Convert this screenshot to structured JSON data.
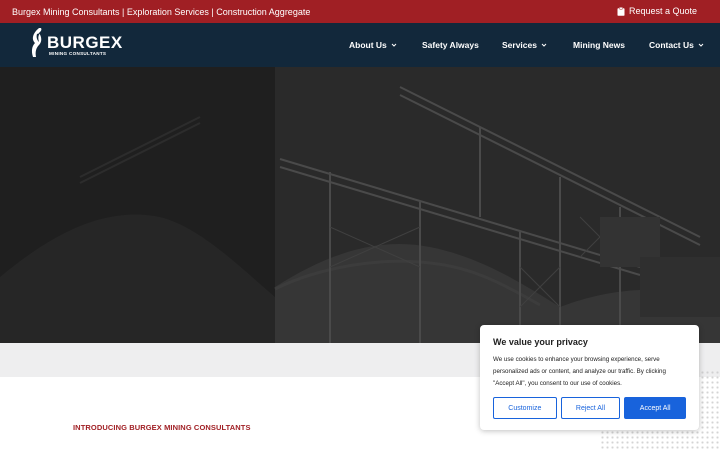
{
  "topbar": {
    "tagline": "Burgex Mining Consultants | Exploration Services | Construction Aggregate",
    "quote_label": "Request a Quote",
    "quote_icon": "clipboard-icon"
  },
  "logo": {
    "word": "BURGEX",
    "sub": "MINING CONSULTANTS"
  },
  "nav": {
    "about": "About Us",
    "safety": "Safety Always",
    "services": "Services",
    "news": "Mining News",
    "contact": "Contact Us"
  },
  "intro": {
    "label": "INTRODUCING BURGEX MINING CONSULTANTS"
  },
  "consent": {
    "title": "We value your privacy",
    "body": "We use cookies to enhance your browsing experience, serve personalized ads or content, and analyze our traffic. By clicking \"Accept All\", you consent to our use of cookies.",
    "customize": "Customize",
    "reject": "Reject All",
    "accept": "Accept All"
  },
  "colors": {
    "brand_red": "#a01f24",
    "nav_navy": "#12283b",
    "consent_blue": "#1863dc"
  }
}
